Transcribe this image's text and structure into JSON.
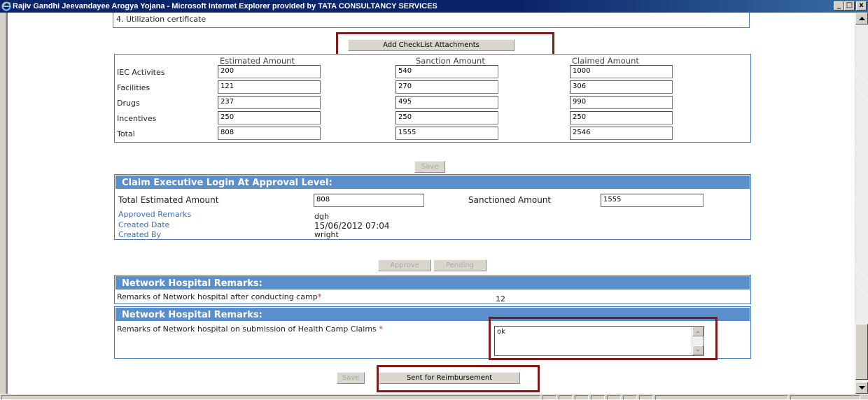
{
  "window": {
    "title": "Rajiv Gandhi Jeevandayee Arogya Yojana - Microsoft Internet Explorer provided by TATA CONSULTANCY SERVICES",
    "minimize": "_",
    "maximize": "□",
    "close": "x"
  },
  "checklist": {
    "item4": "4. Utilization certificate",
    "add_attachments_label": "Add CheckList Attachments"
  },
  "amounts": {
    "headers": {
      "estimated": "Estimated Amount",
      "sanction": "Sanction Amount",
      "claimed": "Claimed Amount"
    },
    "rows": [
      {
        "label": "IEC Activites",
        "estimated": "200",
        "sanction": "540",
        "claimed": "1000"
      },
      {
        "label": "Facilities",
        "estimated": "121",
        "sanction": "270",
        "claimed": "306"
      },
      {
        "label": "Drugs",
        "estimated": "237",
        "sanction": "495",
        "claimed": "990"
      },
      {
        "label": "Incentives",
        "estimated": "250",
        "sanction": "250",
        "claimed": "250"
      },
      {
        "label": "Total",
        "estimated": "808",
        "sanction": "1555",
        "claimed": "2546"
      }
    ],
    "save_label": "Save"
  },
  "approval": {
    "heading": "Claim Executive Login At Approval Level:",
    "total_estimated_label": "Total Estimated Amount",
    "total_estimated_value": "808",
    "sanctioned_label": "Sanctioned Amount",
    "sanctioned_value": "1555",
    "approved_remarks_label": "Approved Remarks",
    "approved_remarks_value": "dgh",
    "created_date_label": "Created Date",
    "created_date_value": "15/06/2012 07:04",
    "created_by_label": "Created By",
    "created_by_value": "wright",
    "approve_label": "Approve",
    "pending_label": "Pending"
  },
  "network1": {
    "heading": "Network Hospital Remarks:",
    "label": "Remarks of Network hospital after conducting camp",
    "required": "*",
    "value": "12"
  },
  "network2": {
    "heading": "Network Hospital Remarks:",
    "label": "Remarks of Network hospital on submission of Health Camp Claims ",
    "required": "*",
    "value": "ok"
  },
  "footer": {
    "save_label": "Save",
    "send_label": "Sent for Reimbursement"
  },
  "colors": {
    "section_header": "#5b8fcc",
    "highlight": "#7b1c1c",
    "box_border": "#4a7cb8"
  }
}
